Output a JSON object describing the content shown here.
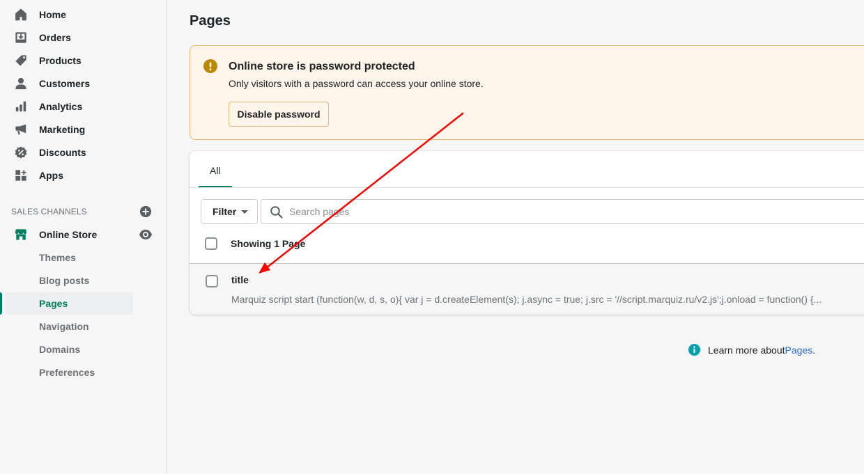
{
  "sidebar": {
    "items": [
      {
        "label": "Home",
        "icon": "home-icon"
      },
      {
        "label": "Orders",
        "icon": "orders-icon"
      },
      {
        "label": "Products",
        "icon": "tag-icon"
      },
      {
        "label": "Customers",
        "icon": "person-icon"
      },
      {
        "label": "Analytics",
        "icon": "bar-chart-icon"
      },
      {
        "label": "Marketing",
        "icon": "megaphone-icon"
      },
      {
        "label": "Discounts",
        "icon": "discount-icon"
      },
      {
        "label": "Apps",
        "icon": "apps-icon"
      }
    ],
    "sales_channels": {
      "title": "SALES CHANNELS",
      "channel": {
        "label": "Online Store",
        "icon": "store-icon"
      },
      "sub_items": [
        {
          "label": "Themes"
        },
        {
          "label": "Blog posts"
        },
        {
          "label": "Pages",
          "active": true
        },
        {
          "label": "Navigation"
        },
        {
          "label": "Domains"
        },
        {
          "label": "Preferences"
        }
      ]
    }
  },
  "page": {
    "title": "Pages"
  },
  "banner": {
    "title": "Online store is password protected",
    "text": "Only visitors with a password can access your online store.",
    "button": "Disable password",
    "icon": "warning-icon"
  },
  "card": {
    "tabs": [
      {
        "label": "All",
        "selected": true
      }
    ],
    "filter_label": "Filter",
    "search_placeholder": "Search pages",
    "search_value": "",
    "showing_label": "Showing 1 Page",
    "rows": [
      {
        "title": "title",
        "excerpt": "Marquiz script start (function(w, d, s, o){ var j = d.createElement(s); j.async = true; j.src = '//script.marquiz.ru/v2.js';j.onload = function() {..."
      }
    ]
  },
  "footer": {
    "learn_more_text": "Learn more about ",
    "learn_more_link": "Pages",
    "learn_more_suffix": "."
  },
  "colors": {
    "accent": "#008060",
    "banner_bg": "#fff5ea",
    "banner_border": "#e1b878",
    "warning": "#b98900",
    "info": "#00a0ac",
    "link": "#2c6ecb",
    "annotation": "#ff0000"
  }
}
